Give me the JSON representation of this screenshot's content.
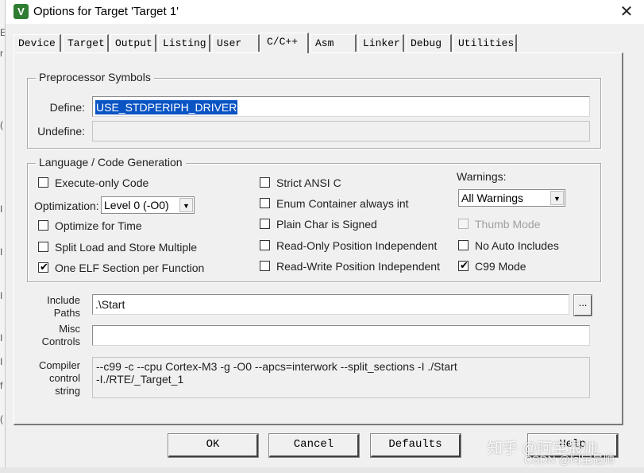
{
  "window": {
    "title": "Options for Target 'Target 1'",
    "close_glyph": "✕",
    "app_icon_glyph": "V"
  },
  "background_chars": [
    "E",
    "r",
    "(",
    "I",
    "I",
    "I",
    "I",
    "I",
    "f",
    "("
  ],
  "tabs": [
    {
      "label": "Device",
      "active": false
    },
    {
      "label": "Target",
      "active": false
    },
    {
      "label": "Output",
      "active": false
    },
    {
      "label": "Listing",
      "active": false
    },
    {
      "label": "User",
      "active": false
    },
    {
      "label": "C/C++",
      "active": true
    },
    {
      "label": "Asm",
      "active": false
    },
    {
      "label": "Linker",
      "active": false
    },
    {
      "label": "Debug",
      "active": false
    },
    {
      "label": "Utilities",
      "active": false
    }
  ],
  "preprocessor": {
    "group_title": "Preprocessor Symbols",
    "define_label": "Define:",
    "define_value": "USE_STDPERIPH_DRIVER",
    "undefine_label": "Undefine:",
    "undefine_value": ""
  },
  "language": {
    "group_title": "Language / Code Generation",
    "execute_only": {
      "label": "Execute-only Code",
      "checked": false
    },
    "optimization_label": "Optimization:",
    "optimization_value": "Level 0 (-O0)",
    "optimize_time": {
      "label": "Optimize for Time",
      "checked": false
    },
    "split_load": {
      "label": "Split Load and Store Multiple",
      "checked": false
    },
    "one_elf": {
      "label": "One ELF Section per Function",
      "checked": true
    },
    "strict_ansi": {
      "label": "Strict ANSI C",
      "checked": false
    },
    "enum_container": {
      "label": "Enum Container always int",
      "checked": false
    },
    "plain_char": {
      "label": "Plain Char is Signed",
      "checked": false
    },
    "ro_pi": {
      "label": "Read-Only Position Independent",
      "checked": false
    },
    "rw_pi": {
      "label": "Read-Write Position Independent",
      "checked": false
    },
    "warnings_label": "Warnings:",
    "warnings_value": "All Warnings",
    "thumb_mode": {
      "label": "Thumb Mode",
      "checked": false,
      "disabled": true
    },
    "no_auto_includes": {
      "label": "No Auto Includes",
      "checked": false
    },
    "c99_mode": {
      "label": "C99 Mode",
      "checked": true
    }
  },
  "paths": {
    "include_label_1": "Include",
    "include_label_2": "Paths",
    "include_value": ".\\Start",
    "browse_label": "...",
    "misc_label_1": "Misc",
    "misc_label_2": "Controls",
    "misc_value": "",
    "compiler_label_1": "Compiler",
    "compiler_label_2": "control",
    "compiler_label_3": "string",
    "compiler_line_1": "--c99 -c --cpu Cortex-M3 -g -O0 --apcs=interwork --split_sections -I ./Start",
    "compiler_line_2": "-I./RTE/_Target_1"
  },
  "buttons": {
    "ok": "OK",
    "cancel": "Cancel",
    "defaults": "Defaults",
    "help": "Help"
  },
  "watermark": {
    "line1": "知乎 @阿宝最帅",
    "line2": "CSDN @阿宝最帅"
  },
  "check_glyph": "✔",
  "dropdown_glyph": "▼"
}
